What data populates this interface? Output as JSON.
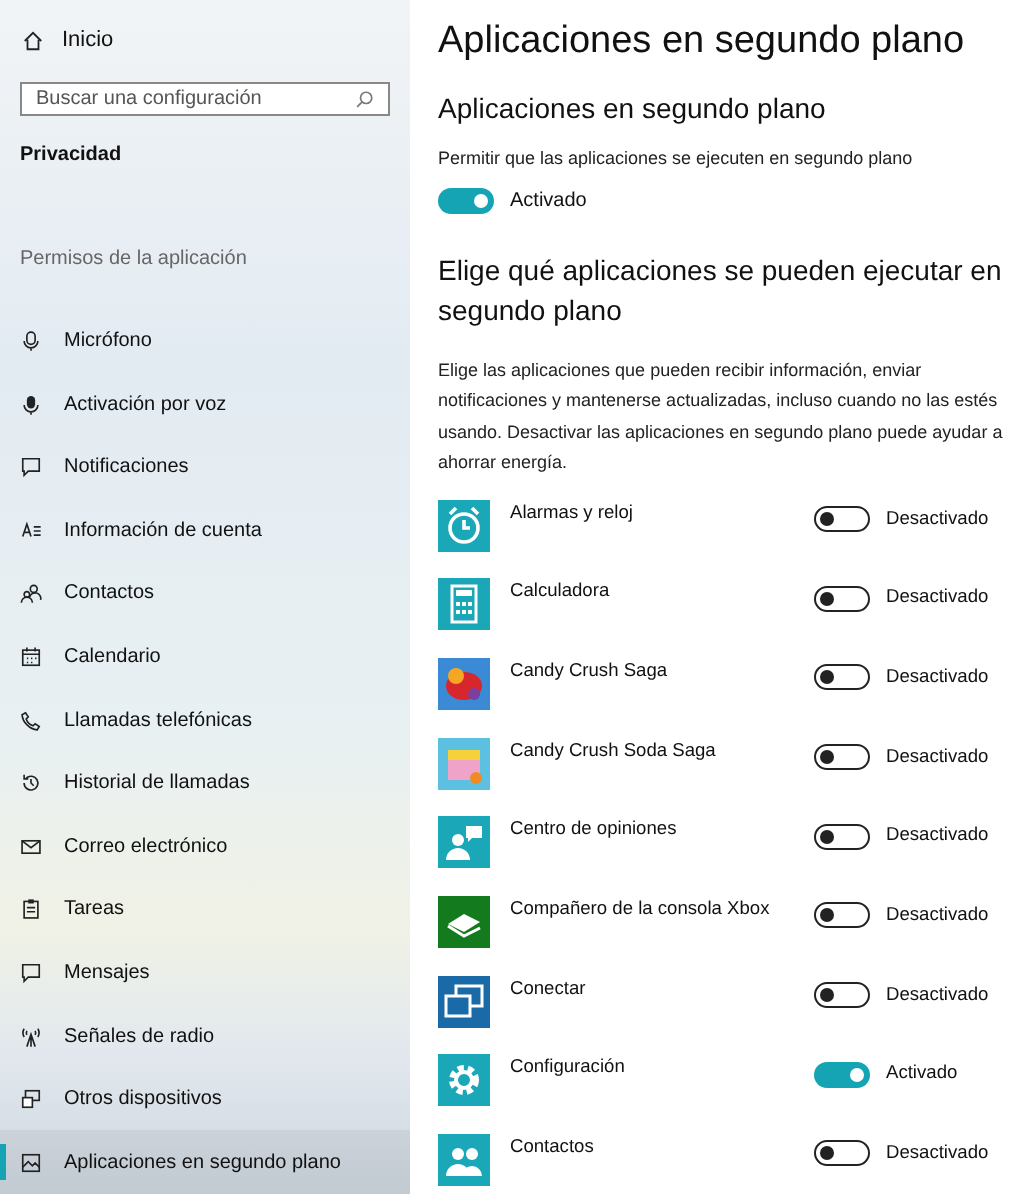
{
  "sidebar": {
    "home": {
      "label": "Inicio"
    },
    "search": {
      "placeholder": "Buscar una configuración"
    },
    "category": "Privacidad",
    "section": "Permisos de la aplicación",
    "items": [
      {
        "label": "Micrófono",
        "selected": false
      },
      {
        "label": "Activación por voz",
        "selected": false
      },
      {
        "label": "Notificaciones",
        "selected": false
      },
      {
        "label": "Información de cuenta",
        "selected": false
      },
      {
        "label": "Contactos",
        "selected": false
      },
      {
        "label": "Calendario",
        "selected": false
      },
      {
        "label": "Llamadas telefónicas",
        "selected": false
      },
      {
        "label": "Historial de llamadas",
        "selected": false
      },
      {
        "label": "Correo electrónico",
        "selected": false
      },
      {
        "label": "Tareas",
        "selected": false
      },
      {
        "label": "Mensajes",
        "selected": false
      },
      {
        "label": "Señales de radio",
        "selected": false
      },
      {
        "label": "Otros dispositivos",
        "selected": false
      },
      {
        "label": "Aplicaciones en segundo plano",
        "selected": true
      }
    ]
  },
  "main": {
    "title": "Aplicaciones en segundo plano",
    "subtitle": "Aplicaciones en segundo plano",
    "master": {
      "label": "Permitir que las aplicaciones se ejecuten en segundo plano",
      "on": true,
      "state": "Activado"
    },
    "heading": "Elige qué aplicaciones se pueden ejecutar en segundo plano",
    "description": "Elige las aplicaciones que pueden recibir información, enviar notificaciones y mantenerse actualizadas, incluso cuando no las estés usando. Desactivar las aplicaciones en segundo plano puede ayudar a ahorrar energía.",
    "apps": [
      {
        "name": "Alarmas y reloj",
        "color": "#1aa7b8",
        "on": false,
        "state": "Desactivado"
      },
      {
        "name": "Calculadora",
        "color": "#1aa7b8",
        "on": false,
        "state": "Desactivado"
      },
      {
        "name": "Candy Crush Saga",
        "color": "#3a8ad6",
        "on": false,
        "state": "Desactivado"
      },
      {
        "name": "Candy Crush Soda Saga",
        "color": "#5cc0e0",
        "on": false,
        "state": "Desactivado"
      },
      {
        "name": "Centro de opiniones",
        "color": "#1aa7b8",
        "on": false,
        "state": "Desactivado"
      },
      {
        "name": "Compañero de la consola Xbox",
        "color": "#137a1e",
        "on": false,
        "state": "Desactivado"
      },
      {
        "name": "Conectar",
        "color": "#1b6aa8",
        "on": false,
        "state": "Desactivado"
      },
      {
        "name": "Configuración",
        "color": "#1aa7b8",
        "on": true,
        "state": "Activado"
      },
      {
        "name": "Contactos",
        "color": "#1aa7b8",
        "on": false,
        "state": "Desactivado"
      }
    ]
  }
}
